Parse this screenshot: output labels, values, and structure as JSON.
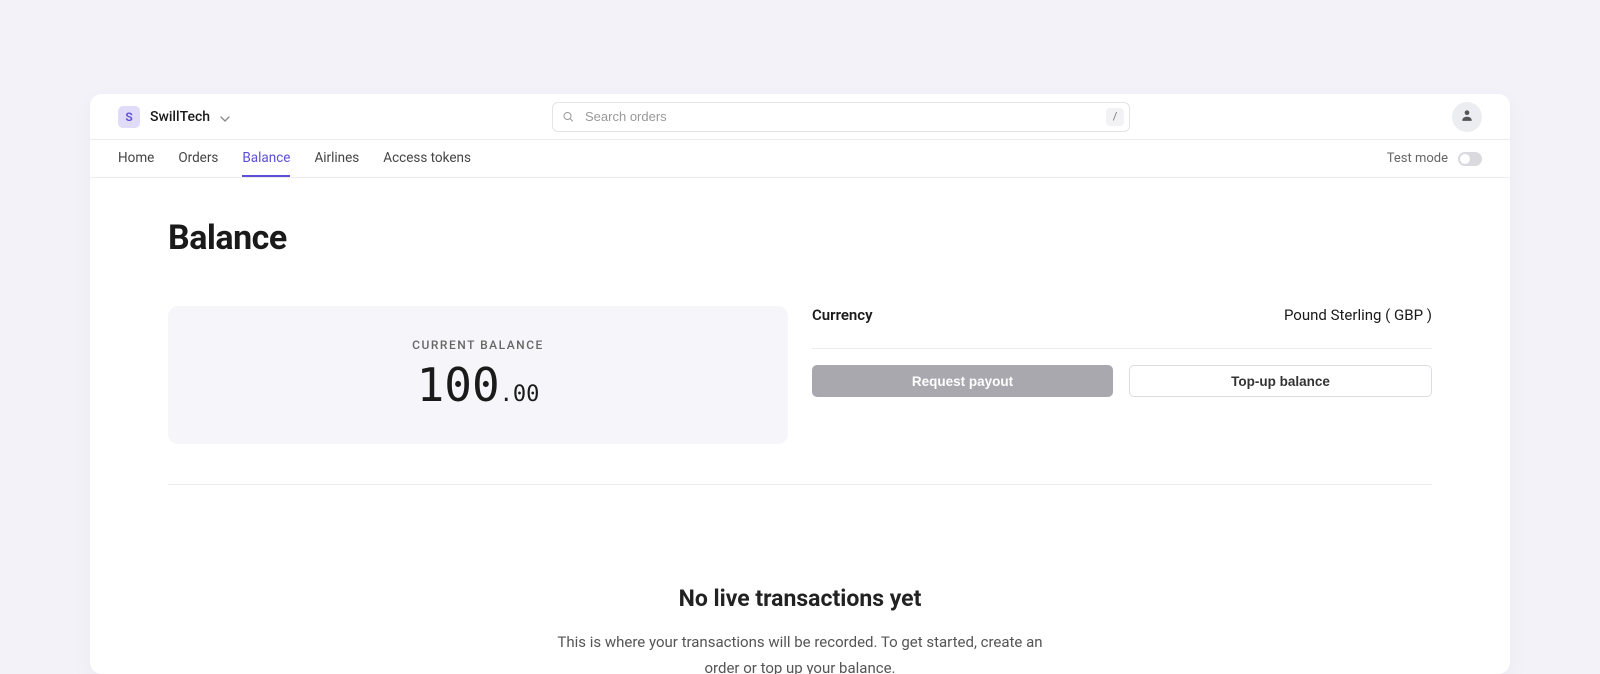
{
  "org": {
    "badge_letter": "S",
    "name": "SwillTech"
  },
  "search": {
    "placeholder": "Search orders",
    "shortcut": "/"
  },
  "nav": {
    "tabs": [
      {
        "label": "Home",
        "active": false
      },
      {
        "label": "Orders",
        "active": false
      },
      {
        "label": "Balance",
        "active": true
      },
      {
        "label": "Airlines",
        "active": false
      },
      {
        "label": "Access tokens",
        "active": false
      }
    ],
    "test_mode_label": "Test mode"
  },
  "page": {
    "title": "Balance"
  },
  "balance": {
    "label": "CURRENT BALANCE",
    "whole": "100",
    "decimal": ".00"
  },
  "currency": {
    "label": "Currency",
    "value": "Pound Sterling ( GBP )"
  },
  "actions": {
    "request_payout": "Request payout",
    "topup": "Top-up balance"
  },
  "empty": {
    "title": "No live transactions yet",
    "description": "This is where your transactions will be recorded. To get started, create an order or top up your balance."
  }
}
